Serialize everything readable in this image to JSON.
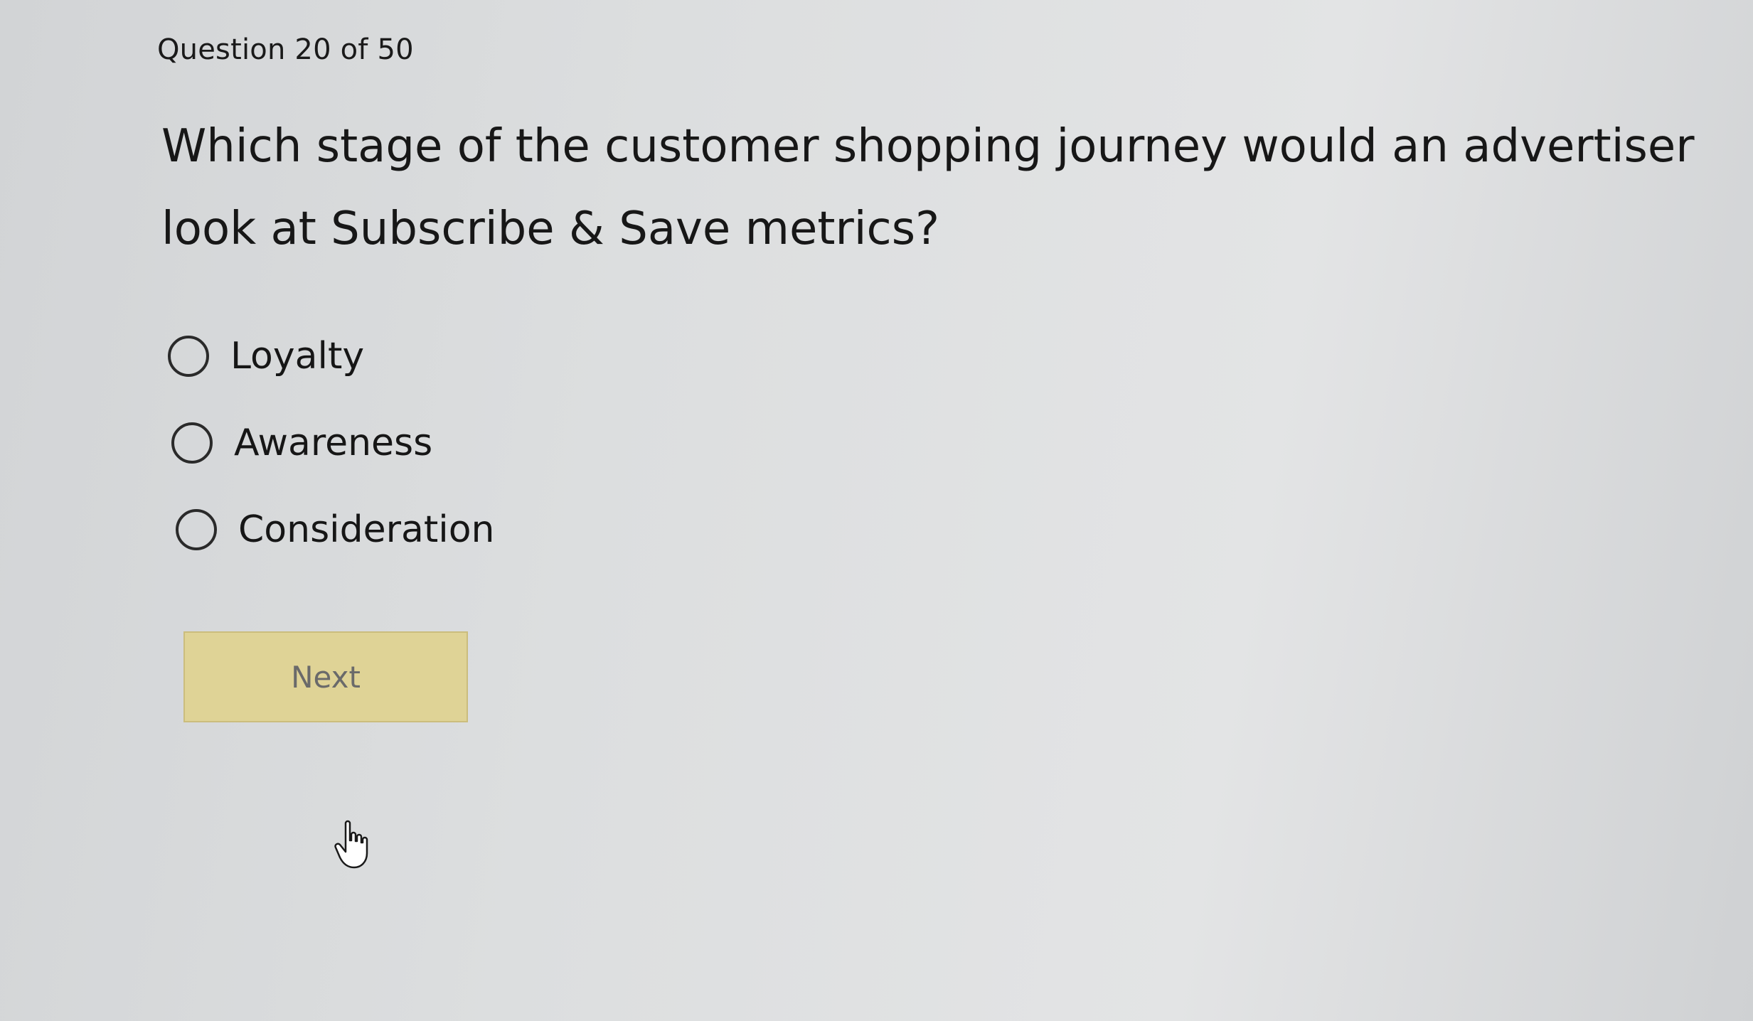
{
  "header": {
    "question_counter": "Question 20 of 50"
  },
  "question": {
    "text": "Which stage of the customer shopping journey would an advertiser look at Subscribe & Save metrics?"
  },
  "options": [
    {
      "label": "Loyalty",
      "selected": false
    },
    {
      "label": "Awareness",
      "selected": false
    },
    {
      "label": "Consideration",
      "selected": false
    }
  ],
  "actions": {
    "next_label": "Next",
    "next_enabled": false
  },
  "colors": {
    "next_button_bg": "#dfd396",
    "background": "#dcdedf"
  },
  "icons": {
    "cursor": "hand-pointer-icon"
  }
}
